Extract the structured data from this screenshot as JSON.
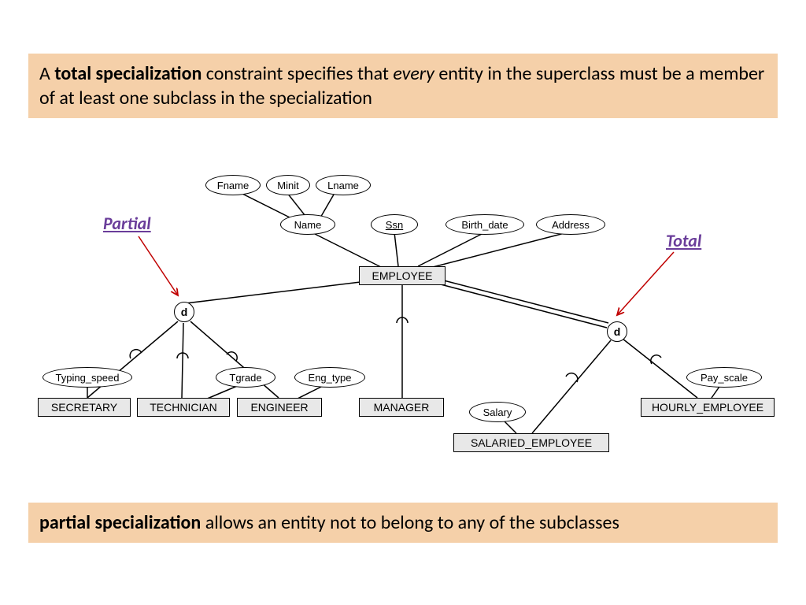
{
  "top_text": {
    "pre": "A ",
    "bold1": "total specialization",
    "mid1": " constraint specifies that ",
    "ital": "every",
    "post": " entity in the superclass must be a member of at least one subclass in the specialization"
  },
  "bottom_text": {
    "bold": "partial specialization",
    "post": " allows an entity not to belong to any of the subclasses"
  },
  "labels": {
    "partial": "Partial",
    "total": "Total"
  },
  "attrs": {
    "fname": "Fname",
    "minit": "Minit",
    "lname": "Lname",
    "name": "Name",
    "ssn": "Ssn",
    "birth_date": "Birth_date",
    "address": "Address",
    "typing_speed": "Typing_speed",
    "tgrade": "Tgrade",
    "eng_type": "Eng_type",
    "salary": "Salary",
    "pay_scale": "Pay_scale"
  },
  "entities": {
    "employee": "EMPLOYEE",
    "secretary": "SECRETARY",
    "technician": "TECHNICIAN",
    "engineer": "ENGINEER",
    "manager": "MANAGER",
    "salaried_employee": "SALARIED_EMPLOYEE",
    "hourly_employee": "HOURLY_EMPLOYEE"
  },
  "d": "d"
}
